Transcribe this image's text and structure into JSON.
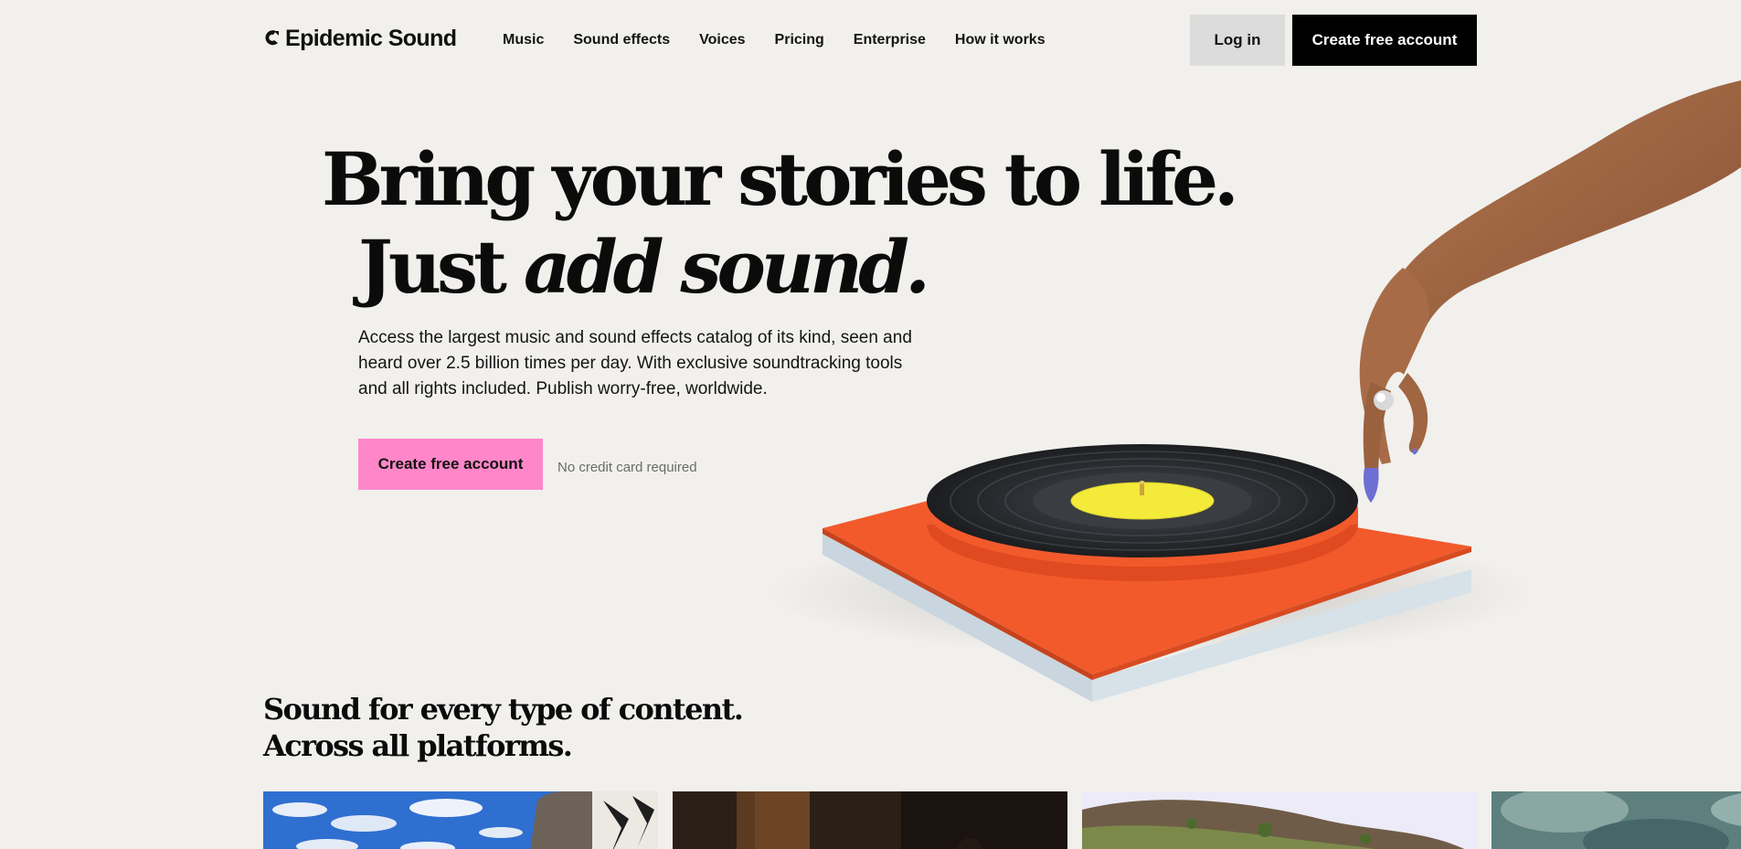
{
  "header": {
    "brand": "Epidemic Sound",
    "nav": [
      {
        "label": "Music"
      },
      {
        "label": "Sound effects"
      },
      {
        "label": "Voices"
      },
      {
        "label": "Pricing"
      },
      {
        "label": "Enterprise"
      },
      {
        "label": "How it works"
      }
    ],
    "login_label": "Log in",
    "create_label": "Create free account"
  },
  "hero": {
    "title_line1": "Bring your stories to life.",
    "title_line2_plain": "Just ",
    "title_line2_italic": "add sound.",
    "description": "Access the largest music and sound effects catalog of its kind, seen and heard over 2.5 billion times per day. With exclusive soundtracking tools and all rights included. Publish worry-free, worldwide.",
    "cta_label": "Create free account",
    "cta_note": "No credit card required"
  },
  "section": {
    "title_line1": "Sound for every type of content.",
    "title_line2": "Across all platforms."
  },
  "colors": {
    "background": "#f1f0ed",
    "cta_pink": "#ff87c9",
    "primary_black": "#000000",
    "login_gray": "#dcdcdc",
    "turntable_orange": "#f25a2c",
    "label_yellow": "#f3ea3a"
  },
  "icons": {
    "logo": "epidemic-sound-logo-icon"
  }
}
